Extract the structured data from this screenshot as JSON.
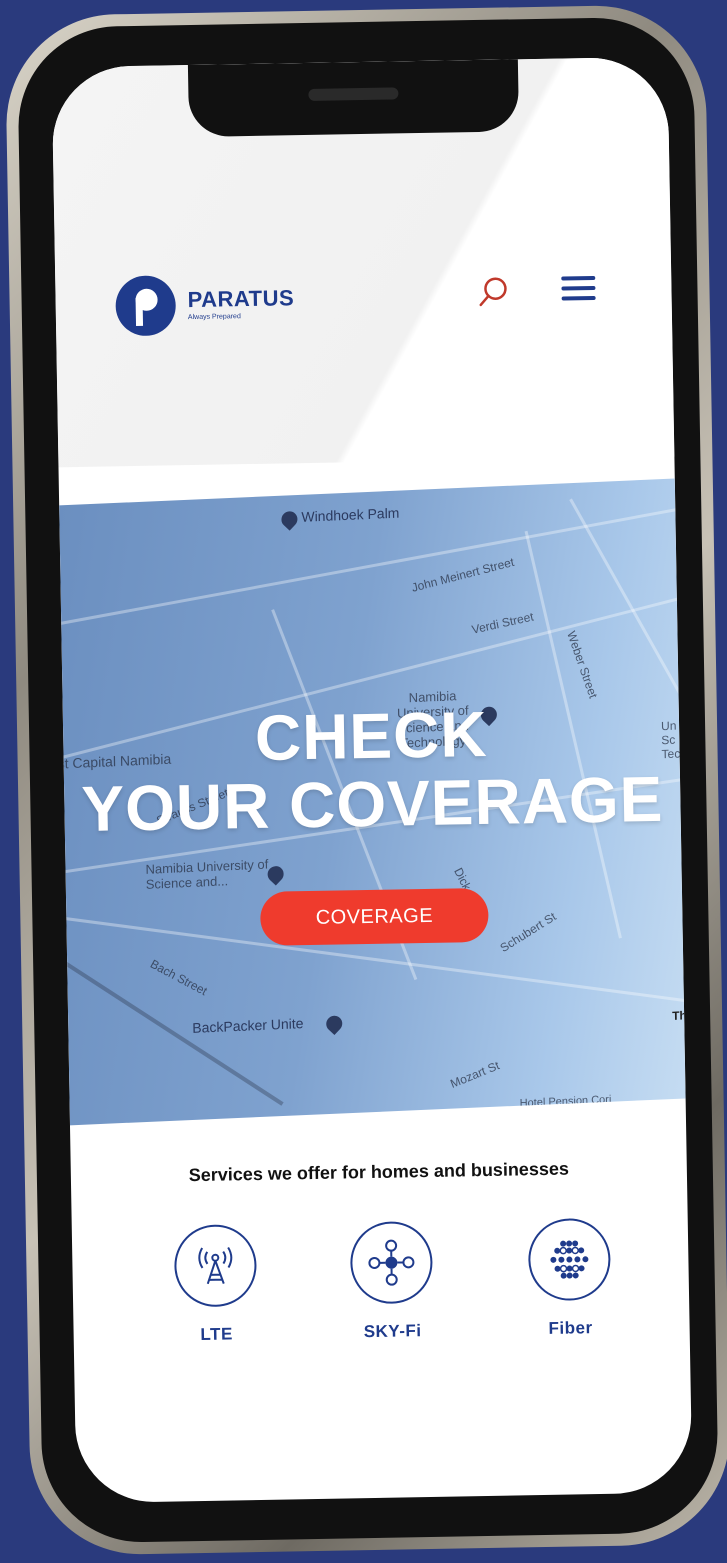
{
  "header": {
    "brand_name": "PARATUS",
    "brand_tagline": "Always Prepared",
    "search_icon": "search-icon",
    "menu_icon": "hamburger-menu-icon"
  },
  "hero": {
    "title_line1": "CHECK",
    "title_line2": "YOUR COVERAGE",
    "cta_label": "COVERAGE",
    "map_labels": [
      "Windhoek Palm",
      "John Meinert Street",
      "Verdi Street",
      "Weber Street",
      "Namibia University of Science and Technology",
      "st Capital Namibia",
      "Strauss Street",
      "Namibia University of Science and...",
      "Dick Street",
      "Schubert St",
      "Bach Street",
      "BackPacker Unite",
      "Mozart St",
      "Hotel Pension Cori",
      "Th",
      "Un Sc Tec"
    ]
  },
  "services": {
    "heading": "Services we offer for homes and businesses",
    "items": [
      {
        "label": "LTE",
        "icon": "lte-tower-icon"
      },
      {
        "label": "SKY-Fi",
        "icon": "skyfi-network-icon"
      },
      {
        "label": "Fiber",
        "icon": "fiber-dots-icon"
      }
    ]
  },
  "colors": {
    "background": "#2a3a7d",
    "brand_blue": "#1f3b8c",
    "cta_red": "#ef3b2d"
  }
}
